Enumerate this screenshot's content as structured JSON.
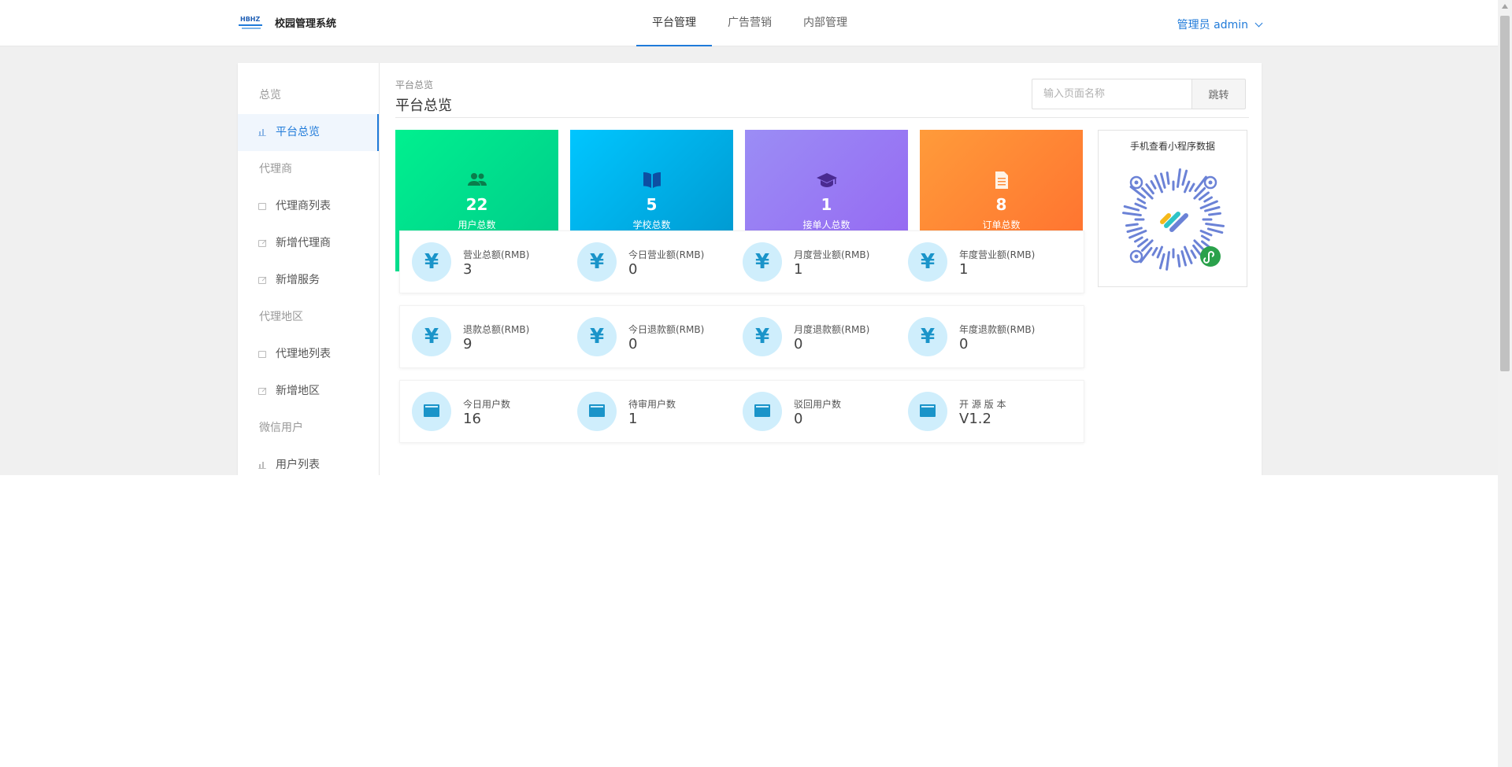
{
  "header": {
    "logo_text": "HBHZ",
    "system_name": "校园管理系统",
    "nav": [
      {
        "label": "平台管理",
        "active": true
      },
      {
        "label": "广告营销",
        "active": false
      },
      {
        "label": "内部管理",
        "active": false
      }
    ],
    "user_label": "管理员 admin"
  },
  "sidebar": {
    "group_overview": "总览",
    "item_platform_overview": "平台总览",
    "group_agent": "代理商",
    "item_agent_list": "代理商列表",
    "item_add_agent": "新增代理商",
    "item_add_service": "新增服务",
    "group_region": "代理地区",
    "item_region_list": "代理地列表",
    "item_add_region": "新增地区",
    "group_wechat": "微信用户",
    "item_user_list": "用户列表"
  },
  "page": {
    "crumb_sub": "平台总览",
    "title": "平台总览",
    "jump_placeholder": "输入页面名称",
    "jump_button": "跳转"
  },
  "cards": [
    {
      "value": "22",
      "label": "用户总数",
      "icon": "users-icon"
    },
    {
      "value": "5",
      "label": "学校总数",
      "icon": "book-icon"
    },
    {
      "value": "1",
      "label": "接单人总数",
      "icon": "graduation-cap-icon"
    },
    {
      "value": "8",
      "label": "订单总数",
      "icon": "document-icon"
    }
  ],
  "qr": {
    "title": "手机查看小程序数据"
  },
  "revenue": [
    {
      "label": "营业总额(RMB)",
      "value": "3",
      "icon": "yen-icon"
    },
    {
      "label": "今日营业额(RMB)",
      "value": "0",
      "icon": "yen-icon"
    },
    {
      "label": "月度营业额(RMB)",
      "value": "1",
      "icon": "yen-icon"
    },
    {
      "label": "年度营业额(RMB)",
      "value": "1",
      "icon": "yen-icon"
    }
  ],
  "refund": [
    {
      "label": "退款总额(RMB)",
      "value": "9",
      "icon": "yen-icon"
    },
    {
      "label": "今日退款额(RMB)",
      "value": "0",
      "icon": "yen-icon"
    },
    {
      "label": "月度退款额(RMB)",
      "value": "0",
      "icon": "yen-icon"
    },
    {
      "label": "年度退款额(RMB)",
      "value": "0",
      "icon": "yen-icon"
    }
  ],
  "users": [
    {
      "label": "今日用户数",
      "value": "16",
      "icon": "calendar-icon"
    },
    {
      "label": "待审用户数",
      "value": "1",
      "icon": "calendar-icon"
    },
    {
      "label": "驳回用户数",
      "value": "0",
      "icon": "calendar-icon"
    },
    {
      "label": "开 源 版 本",
      "value": "V1.2",
      "icon": "calendar-icon"
    }
  ],
  "symbols": {
    "yen": "¥"
  },
  "colors": {
    "accent": "#1f7ad9",
    "card_green": "#00d98c",
    "card_cyan": "#00b4ea",
    "card_purple": "#9a7bf3",
    "card_orange": "#ff8535",
    "stat_icon_bg": "#cfeefc",
    "stat_icon_fg": "#1a94c9"
  }
}
